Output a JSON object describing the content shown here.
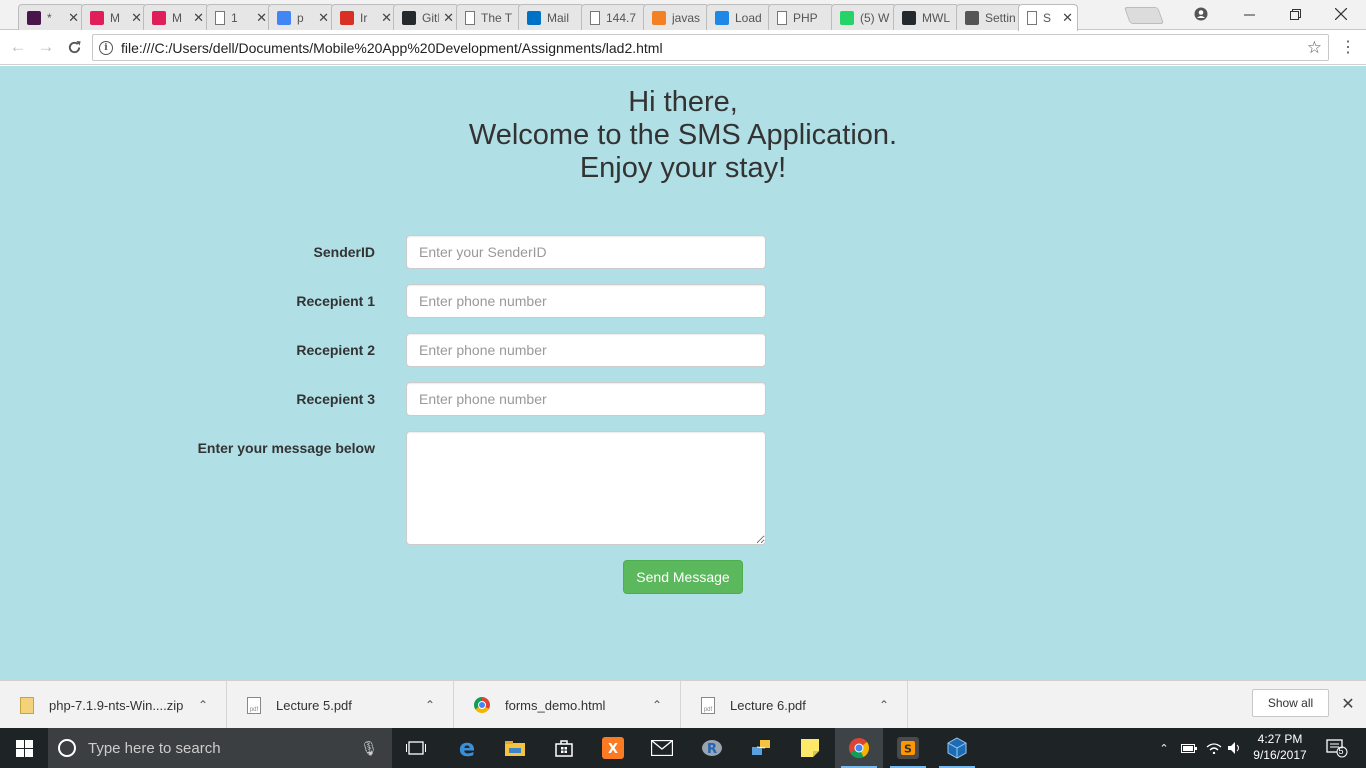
{
  "browser": {
    "tabs": [
      {
        "label": "*",
        "icon": "hash-icon",
        "color": "#4a154b"
      },
      {
        "label": "M",
        "icon": "slack-icon",
        "color": "#e01e5a"
      },
      {
        "label": "M",
        "icon": "slack-icon",
        "color": "#e01e5a"
      },
      {
        "label": "1",
        "icon": "page-icon",
        "color": "#ffffff"
      },
      {
        "label": "p",
        "icon": "google-icon",
        "color": "#4285f4"
      },
      {
        "label": "Ir",
        "icon": "gmail-icon",
        "color": "#d93025"
      },
      {
        "label": "GitH",
        "icon": "github-icon",
        "color": "#24292e"
      },
      {
        "label": "The T",
        "icon": "page-icon",
        "color": "#ffffff"
      },
      {
        "label": "Mail",
        "icon": "outlook-icon",
        "color": "#0072c6"
      },
      {
        "label": "144.7",
        "icon": "page-icon",
        "color": "#ffffff"
      },
      {
        "label": "javas",
        "icon": "stackoverflow-icon",
        "color": "#f48024"
      },
      {
        "label": "Load",
        "icon": "code-icon",
        "color": "#1e88e5"
      },
      {
        "label": "PHP",
        "icon": "page-icon",
        "color": "#ffffff"
      },
      {
        "label": "(5) W",
        "icon": "whatsapp-icon",
        "color": "#25d366"
      },
      {
        "label": "MWL",
        "icon": "github-icon",
        "color": "#24292e"
      },
      {
        "label": "Settin",
        "icon": "settings-icon",
        "color": "#555555"
      },
      {
        "label": "S",
        "icon": "page-icon",
        "color": "#ffffff"
      }
    ],
    "url": "file:///C:/Users/dell/Documents/Mobile%20App%20Development/Assignments/lad2.html"
  },
  "page": {
    "greeting_lines": [
      "Hi there,",
      "Welcome to the SMS Application.",
      "Enjoy your stay!"
    ],
    "fields": [
      {
        "label": "SenderID",
        "placeholder": "Enter your SenderID"
      },
      {
        "label": "Recepient 1",
        "placeholder": "Enter phone number"
      },
      {
        "label": "Recepient 2",
        "placeholder": "Enter phone number"
      },
      {
        "label": "Recepient 3",
        "placeholder": "Enter phone number"
      }
    ],
    "message_label": "Enter your message below",
    "message_value": "",
    "send_button": "Send Message",
    "background_color": "#b0dfe5",
    "button_color": "#5cb85c"
  },
  "downloads": {
    "items": [
      {
        "name": "php-7.1.9-nts-Win....zip",
        "type": "zip"
      },
      {
        "name": "Lecture 5.pdf",
        "type": "pdf"
      },
      {
        "name": "forms_demo.html",
        "type": "chrome"
      },
      {
        "name": "Lecture 6.pdf",
        "type": "pdf"
      }
    ],
    "show_all": "Show all"
  },
  "taskbar": {
    "search_placeholder": "Type here to search",
    "time": "4:27 PM",
    "date": "9/16/2017",
    "notification_count": "5"
  }
}
